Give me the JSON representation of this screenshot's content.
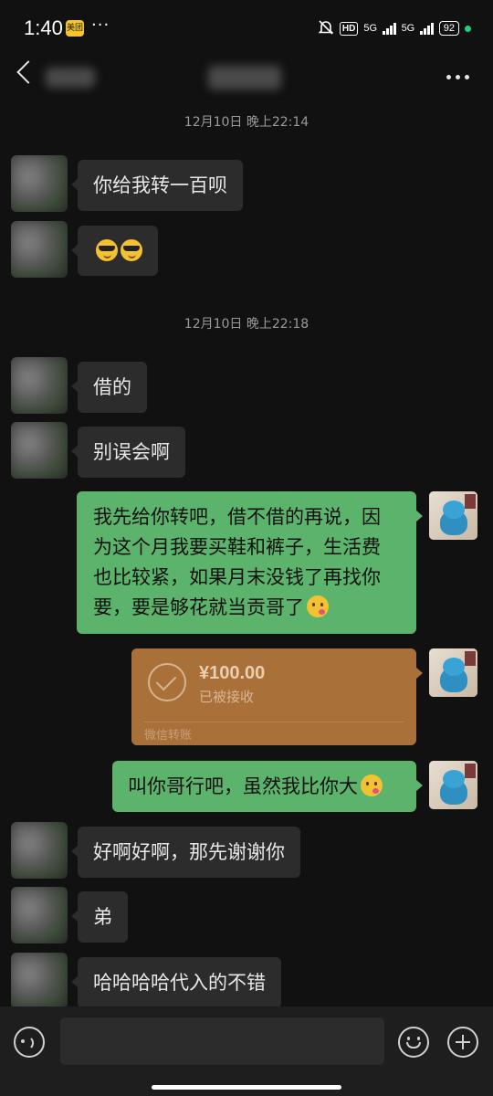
{
  "status_bar": {
    "time": "1:40",
    "app_badge": "美团",
    "overflow": "···",
    "hd": "HD",
    "net1": "5G",
    "net2": "5G",
    "battery": "92"
  },
  "nav": {
    "back_icon": "chevron-left-icon",
    "more_icon": "more-dots-icon"
  },
  "messages": {
    "ts1": "12月10日 晚上22:14",
    "m1": "你给我转一百呗",
    "m2_emoji": [
      "sunglasses-emoji",
      "sunglasses-emoji"
    ],
    "ts2": "12月10日 晚上22:18",
    "m3": "借的",
    "m4": "别误会啊",
    "m5_lines": [
      "我先给你转吧，借不借的再说，因",
      "为这个月我要买鞋和裤子，生活费",
      "也比较紧，如果月末没钱了再找你",
      "要，要是够花就当贡哥了"
    ],
    "m5_emoji": "kissing-emoji",
    "transfer": {
      "amount": "¥100.00",
      "status": "已被接收",
      "footer": "微信转账"
    },
    "m6": "叫你哥行吧，虽然我比你大",
    "m6_emoji": "kissing-emoji",
    "m7": "好啊好啊，那先谢谢你",
    "m8": "弟",
    "m9": "哈哈哈哈代入的不错"
  },
  "input_bar": {
    "voice_icon": "voice-icon",
    "emoji_icon": "emoji-icon",
    "plus_icon": "plus-icon"
  },
  "colors": {
    "background": "#111111",
    "incoming_bubble": "#2c2c2c",
    "outgoing_bubble": "#5cb36c",
    "transfer_card": "#a9703a"
  }
}
